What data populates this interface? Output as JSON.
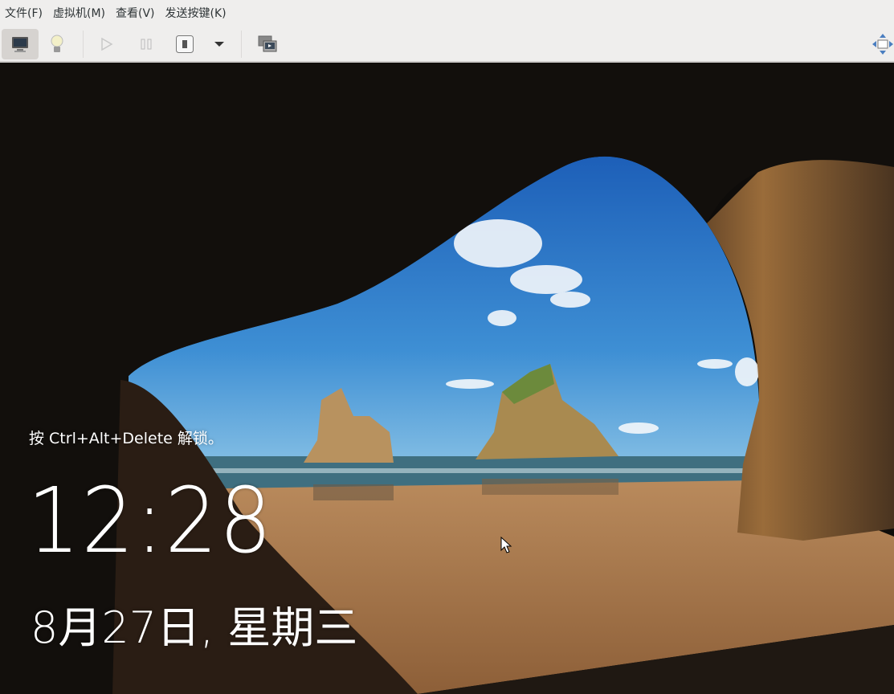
{
  "menubar": {
    "items": [
      "文件(F)",
      "虚拟机(M)",
      "查看(V)",
      "发送按键(K)"
    ]
  },
  "toolbar": {
    "buttons": [
      "console-view",
      "details-view",
      "run",
      "pause",
      "shutdown",
      "shutdown-menu",
      "snapshots",
      "fullscreen"
    ]
  },
  "lockscreen": {
    "hint": "按 Ctrl+Alt+Delete 解锁。",
    "time": "12:28",
    "date": "8月27日, 星期三"
  },
  "colors": {
    "toolbar_bg": "#efeeed",
    "sky": "#2f7fd0",
    "sand": "#b58355"
  }
}
